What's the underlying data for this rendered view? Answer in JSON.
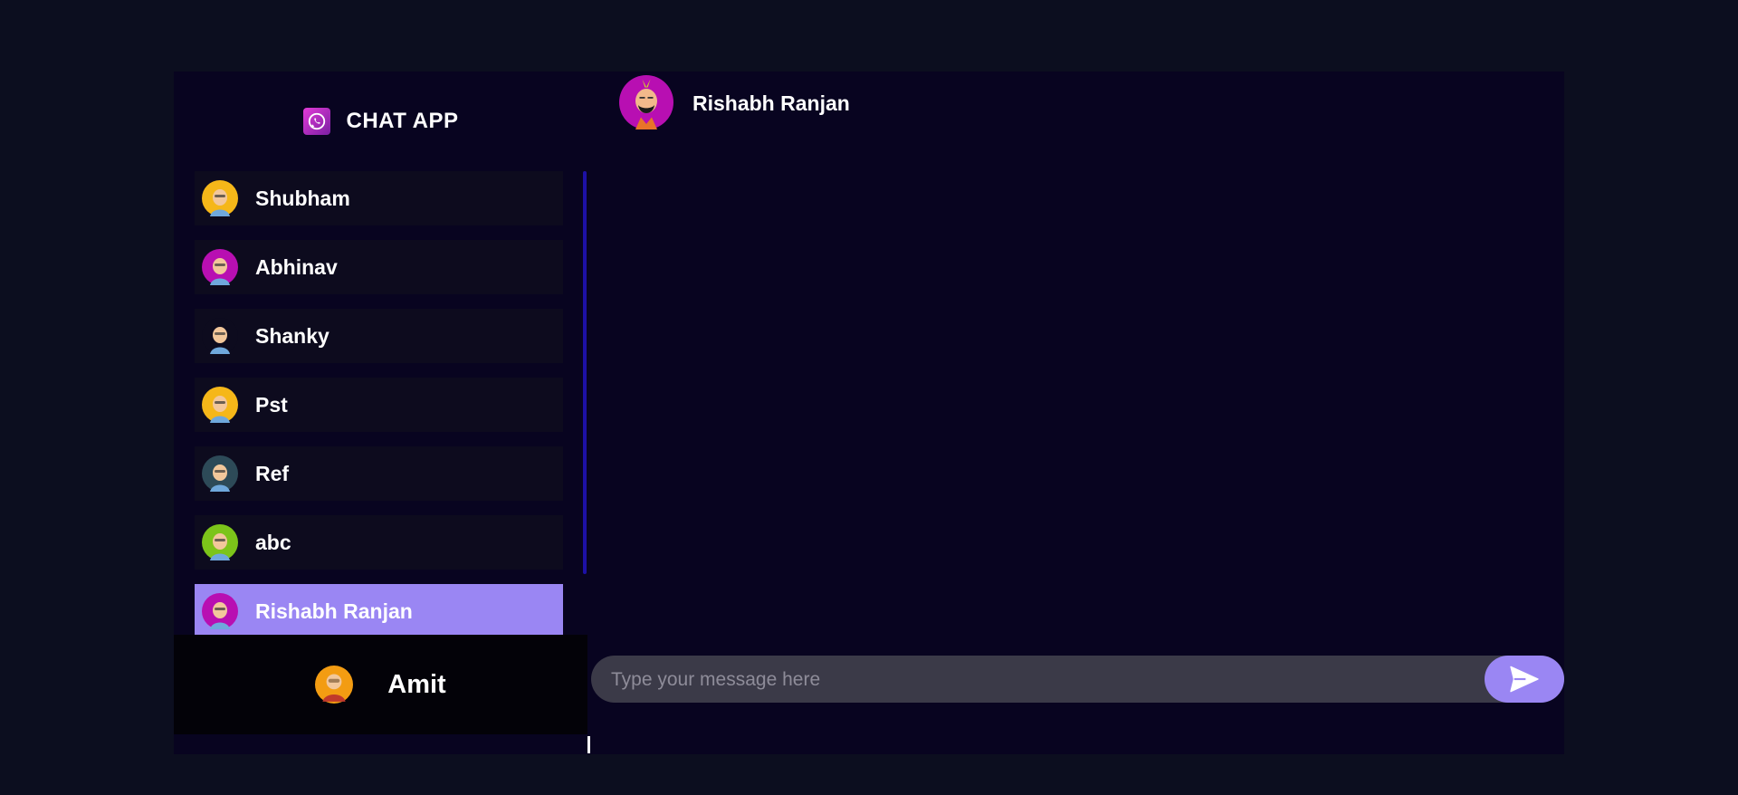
{
  "brand": {
    "title": "CHAT APP",
    "logo_icon": "whatsapp-icon"
  },
  "contacts": [
    {
      "name": "Shubham",
      "avatar_icon": "avatar-icon",
      "avatar_bg": "#f5b719",
      "selected": false
    },
    {
      "name": "Abhinav",
      "avatar_icon": "avatar-icon",
      "avatar_bg": "#b80fb2",
      "selected": false
    },
    {
      "name": "Shanky",
      "avatar_icon": "avatar-icon",
      "avatar_bg": "#0d0b1e",
      "selected": false
    },
    {
      "name": "Pst",
      "avatar_icon": "avatar-icon",
      "avatar_bg": "#f5b719",
      "selected": false
    },
    {
      "name": "Ref",
      "avatar_icon": "avatar-icon",
      "avatar_bg": "#2d4a58",
      "selected": false
    },
    {
      "name": "abc",
      "avatar_icon": "avatar-icon",
      "avatar_bg": "#7cc41a",
      "selected": false
    },
    {
      "name": "Rishabh Ranjan",
      "avatar_icon": "avatar-icon",
      "avatar_bg": "#b80fb2",
      "selected": true
    }
  ],
  "current_user": {
    "name": "Amit",
    "avatar_icon": "avatar-icon",
    "avatar_bg": "#f39c12"
  },
  "chat": {
    "contact_name": "Rishabh Ranjan",
    "contact_avatar_bg": "#b80fb2",
    "logout_icon": "power-icon",
    "input_placeholder": "Type your message here",
    "send_icon": "send-icon"
  },
  "colors": {
    "page_bg": "#0c0e1f",
    "app_bg": "#080420",
    "accent": "#9a86f3",
    "item_bg": "#0d0b1e",
    "input_bg": "#3b3a48",
    "scrollbar": "#1d10a6"
  }
}
